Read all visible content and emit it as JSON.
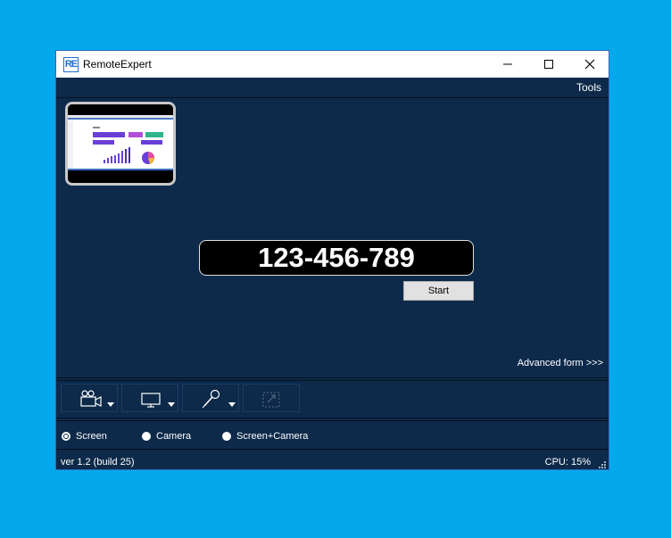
{
  "window": {
    "title": "RemoteExpert",
    "logo_text": "RE"
  },
  "menu": {
    "tools_label": "Tools"
  },
  "main": {
    "session_id": "123-456-789",
    "start_label": "Start",
    "advanced_label": "Advanced form >>>"
  },
  "toolbar": {
    "buttons": [
      {
        "icon": "video-camera-icon",
        "enabled": true,
        "has_dropdown": true
      },
      {
        "icon": "monitor-icon",
        "enabled": true,
        "has_dropdown": true
      },
      {
        "icon": "microphone-icon",
        "enabled": true,
        "has_dropdown": true
      },
      {
        "icon": "screen-region-icon",
        "enabled": false,
        "has_dropdown": false
      }
    ]
  },
  "mode": {
    "options": [
      {
        "label": "Screen",
        "selected": true
      },
      {
        "label": "Camera",
        "selected": false
      },
      {
        "label": "Screen+Camera",
        "selected": false
      }
    ]
  },
  "status": {
    "version": "ver 1.2 (build 25)",
    "cpu": "CPU: 15%"
  },
  "colors": {
    "desktop": "#03a9ec",
    "window_bg": "#0d2a4a",
    "accent_border": "#2a6bb8"
  }
}
